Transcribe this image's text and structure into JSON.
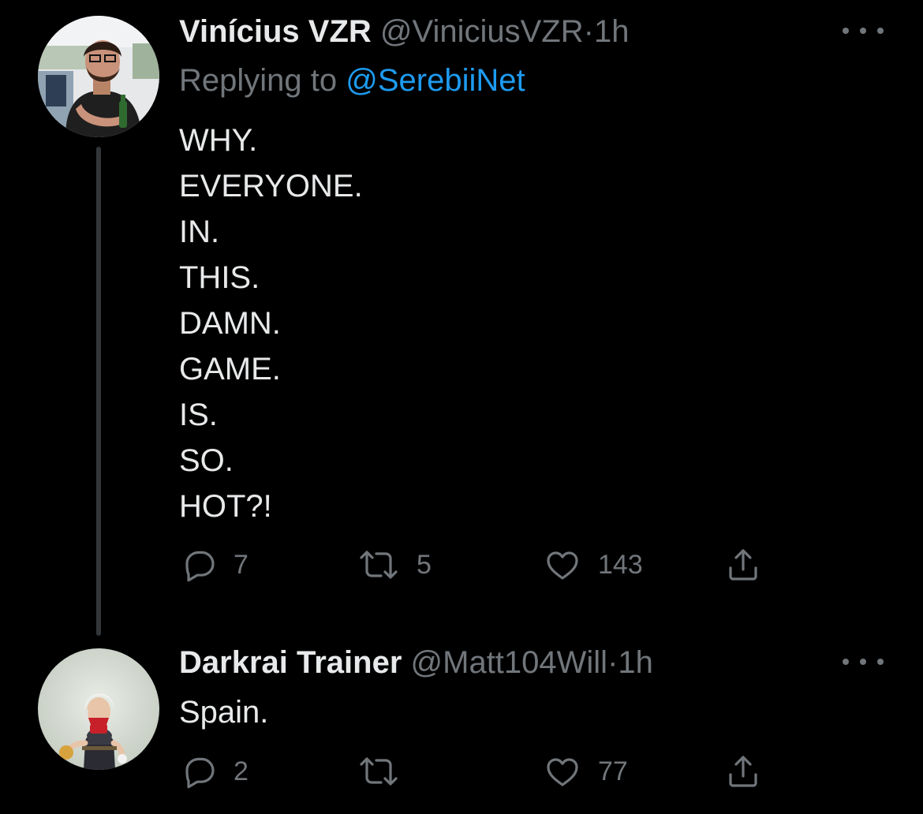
{
  "tweets": [
    {
      "display_name": "Vinícius VZR",
      "handle": "@ViniciusVZR",
      "separator": "·",
      "time": "1h",
      "replying_prefix": "Replying to",
      "replying_to": "@SerebiiNet",
      "lines": [
        "WHY.",
        "EVERYONE.",
        "IN.",
        "THIS.",
        "DAMN.",
        "GAME.",
        "IS.",
        "SO.",
        "HOT?!"
      ],
      "reply_count": "7",
      "retweet_count": "5",
      "like_count": "143"
    },
    {
      "display_name": "Darkrai Trainer",
      "handle": "@Matt104Will",
      "separator": "·",
      "time": "1h",
      "text": "Spain.",
      "reply_count": "2",
      "retweet_count": "",
      "like_count": "77"
    }
  ],
  "icons": {
    "reply": "reply-icon",
    "retweet": "retweet-icon",
    "like": "like-icon",
    "share": "share-icon",
    "more": "more-icon"
  },
  "colors": {
    "background": "#000000",
    "text": "#e7e9ea",
    "secondary": "#71767b",
    "link": "#1d9bf0",
    "thread_line": "#333639"
  }
}
